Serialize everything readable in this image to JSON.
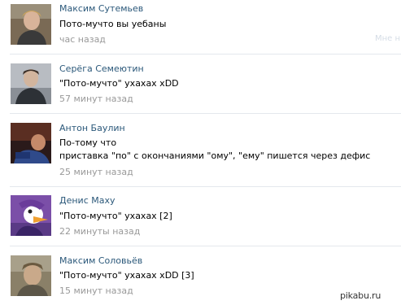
{
  "comments": [
    {
      "author": "Максим Сутемьев",
      "text": "Пото-мучто вы уебаны",
      "time": "час назад",
      "like_hint": "Мне н"
    },
    {
      "author": "Серёга Семеютин",
      "text": "\"Пото-мучто\" ухахах xDD",
      "time": "57 минут назад"
    },
    {
      "author": "Антон Баулин",
      "text_line1": "По-тому что",
      "text_line2": "приставка \"по\" с окончаниями \"ому\", \"ему\" пишется через дефис",
      "time": "25 минут назад"
    },
    {
      "author": "Денис Маху",
      "text": "\"Пото-мучто\" ухахах [2]",
      "time": "22 минуты назад"
    },
    {
      "author": "Максим Соловьёв",
      "text": "\"Пото-мучто\" ухахах xDD [3]",
      "time": "15 минут назад"
    }
  ],
  "watermark": "pikabu.ru",
  "colors": {
    "author_link": "#2b587a",
    "time_gray": "#999999",
    "divider": "#e4e8ed"
  }
}
